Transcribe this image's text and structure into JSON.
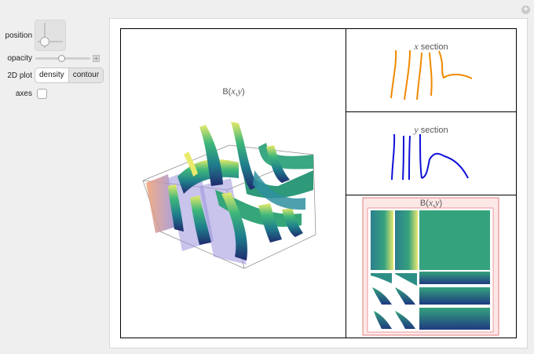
{
  "controls": {
    "position_label": "position",
    "opacity_label": "opacity",
    "opacity_value": 0.45,
    "plot2d_label": "2D plot",
    "plot2d_options": [
      "density",
      "contour"
    ],
    "plot2d_selected": "density",
    "axes_label": "axes",
    "axes_checked": false
  },
  "plots": {
    "main_title_func": "B(",
    "main_title_vars": "x,y",
    "main_title_end": ")",
    "xsection_var": "x",
    "xsection_text": " section",
    "ysection_var": "y",
    "ysection_text": " section",
    "density_title_func": "B(",
    "density_title_vars": "x,y",
    "density_title_end": ")"
  },
  "colors": {
    "xsection": "#f08a00",
    "ysection": "#1010d8",
    "density_frame": "#e06060"
  }
}
